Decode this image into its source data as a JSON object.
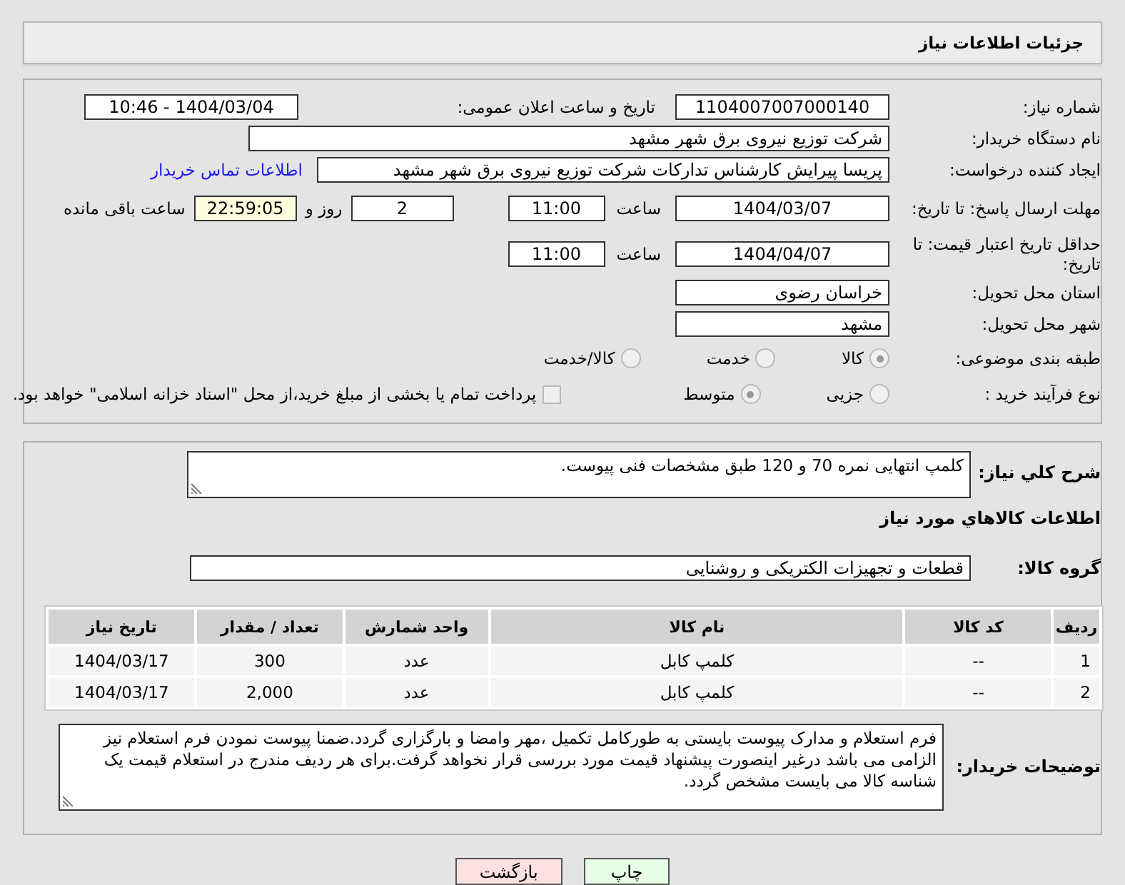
{
  "header": {
    "title": "جزئیات اطلاعات نیاز"
  },
  "need_number": {
    "label": "شماره نیاز:",
    "value": "1104007007000140"
  },
  "announce": {
    "label": "تاریخ و ساعت اعلان عمومی:",
    "value": "1404/03/04 - 10:46"
  },
  "buyer_org": {
    "label": "نام دستگاه خریدار:",
    "value": "شرکت توزیع نیروی برق شهر مشهد"
  },
  "requester": {
    "label": "ایجاد کننده درخواست:",
    "value": "پریسا پیرایش کارشناس تدارکات شرکت توزیع نیروی برق شهر مشهد",
    "link": "اطلاعات تماس خریدار"
  },
  "reply_deadline": {
    "label": "مهلت ارسال پاسخ: تا تاریخ:",
    "date": "1404/03/07",
    "time_label": "ساعت",
    "time": "11:00",
    "days": "2",
    "days_label": "روز و",
    "remaining": "22:59:05",
    "remaining_label": "ساعت باقی مانده"
  },
  "price_validity": {
    "label": "حداقل تاریخ اعتبار قیمت: تا تاریخ:",
    "date": "1404/04/07",
    "time_label": "ساعت",
    "time": "11:00"
  },
  "province": {
    "label": "استان محل تحویل:",
    "value": "خراسان رضوی"
  },
  "city": {
    "label": "شهر محل تحویل:",
    "value": "مشهد"
  },
  "category": {
    "label": "طبقه بندی موضوعی:",
    "options": [
      {
        "label": "کالا",
        "selected": true,
        "disabled": true
      },
      {
        "label": "خدمت",
        "selected": false,
        "disabled": true
      },
      {
        "label": "کالا/خدمت",
        "selected": false,
        "disabled": true
      }
    ]
  },
  "process": {
    "label": "نوع فرآیند خرید :",
    "options": [
      {
        "label": "جزیی",
        "selected": false,
        "disabled": true
      },
      {
        "label": "متوسط",
        "selected": true,
        "disabled": true
      }
    ],
    "payment_note": {
      "label": "پرداخت تمام یا بخشی از مبلغ خرید،از محل \"اسناد خزانه اسلامی\" خواهد بود.",
      "checked": false
    }
  },
  "description": {
    "label": "شرح کلي نياز:",
    "value": "کلمپ انتهایی نمره 70 و 120 طبق مشخصات فنی پیوست."
  },
  "goods_heading": "اطلاعات کالاهاي مورد نياز",
  "goods_group": {
    "label": "گروه کالا:",
    "value": "قطعات و تجهیزات الکتریکی و روشنایی"
  },
  "table": {
    "columns": [
      "رديف",
      "کد کالا",
      "نام کالا",
      "واحد شمارش",
      "تعداد / مقدار",
      "تاریخ نیاز"
    ],
    "rows": [
      [
        "1",
        "--",
        "کلمپ کابل",
        "عدد",
        "300",
        "1404/03/17"
      ],
      [
        "2",
        "--",
        "کلمپ کابل",
        "عدد",
        "2,000",
        "1404/03/17"
      ]
    ]
  },
  "buyer_notes": {
    "label": "توضیحات خریدار:",
    "value": "فرم استعلام و مدارک پیوست بایستی به طورکامل تکمیل ،مهر وامضا و بارگزاری گردد.ضمنا پیوست نمودن فرم استعلام نیز الزامی می باشد درغیر اینصورت پیشنهاد قیمت مورد بررسی قرار نخواهد گرفت.برای هر ردیف مندرج در استعلام قیمت یک شناسه کالا می بایست مشخص گردد."
  },
  "buttons": [
    {
      "label": "چاپ",
      "kind": "print"
    },
    {
      "label": "بازگشت",
      "kind": "back"
    }
  ]
}
